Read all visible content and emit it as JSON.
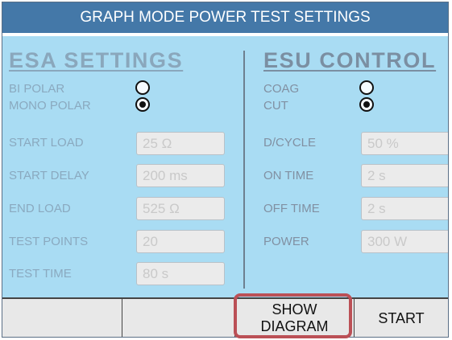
{
  "header": {
    "title": "GRAPH MODE POWER TEST SETTINGS"
  },
  "esa": {
    "title": "ESA SETTINGS",
    "radios": [
      {
        "label": "BI POLAR",
        "selected": false
      },
      {
        "label": "MONO POLAR",
        "selected": true
      }
    ],
    "fields": [
      {
        "label": "START LOAD",
        "value": "25 Ω"
      },
      {
        "label": "START DELAY",
        "value": "200 ms"
      },
      {
        "label": "END LOAD",
        "value": "525 Ω"
      },
      {
        "label": "TEST POINTS",
        "value": "20"
      },
      {
        "label": "TEST TIME",
        "value": "80 s"
      }
    ]
  },
  "esu": {
    "title": "ESU CONTROL",
    "radios": [
      {
        "label": "COAG",
        "selected": false
      },
      {
        "label": "CUT",
        "selected": true
      }
    ],
    "fields": [
      {
        "label": "D/CYCLE",
        "value": "50 %"
      },
      {
        "label": "ON TIME",
        "value": "2 s"
      },
      {
        "label": "OFF TIME",
        "value": "2 s"
      },
      {
        "label": "POWER",
        "value": "300 W"
      }
    ]
  },
  "footer": {
    "buttons": [
      {
        "label": ""
      },
      {
        "label": ""
      },
      {
        "label_line1": "SHOW",
        "label_line2": "DIAGRAM",
        "highlighted": true
      },
      {
        "label": "START"
      }
    ]
  },
  "colors": {
    "header_bg": "#4478a8",
    "panel_bg": "#a9dcf3",
    "highlight": "#bb5056"
  }
}
